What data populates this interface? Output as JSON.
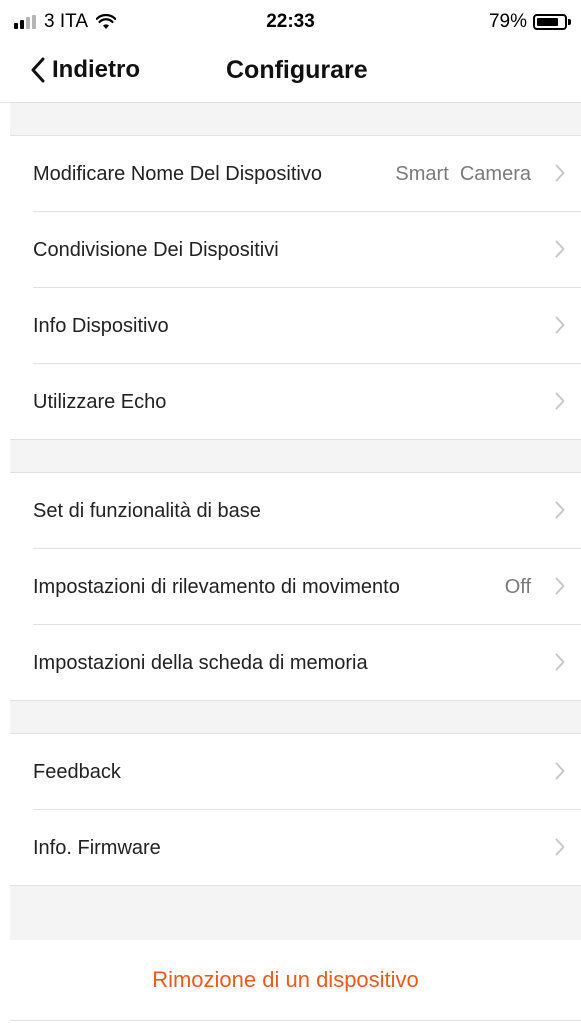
{
  "status_bar": {
    "carrier": "3 ITA",
    "time": "22:33",
    "battery_percent": "79%",
    "battery_level": 0.79
  },
  "nav": {
    "back_label": "Indietro",
    "title": "Configurare"
  },
  "sections": [
    {
      "rows": [
        {
          "name": "row-rename-device",
          "label": "Modificare Nome Del Dispositivo",
          "value": "Smart  Camera"
        },
        {
          "name": "row-device-sharing",
          "label": "Condivisione Dei Dispositivi",
          "value": ""
        },
        {
          "name": "row-device-info",
          "label": "Info Dispositivo",
          "value": ""
        },
        {
          "name": "row-use-echo",
          "label": "Utilizzare Echo",
          "value": ""
        }
      ]
    },
    {
      "rows": [
        {
          "name": "row-basic-features",
          "label": "Set di funzionalità di base",
          "value": ""
        },
        {
          "name": "row-motion-detection",
          "label": "Impostazioni di rilevamento di movimento",
          "value": "Off"
        },
        {
          "name": "row-memory-card",
          "label": "Impostazioni della scheda di memoria",
          "value": ""
        }
      ]
    },
    {
      "rows": [
        {
          "name": "row-feedback",
          "label": "Feedback",
          "value": ""
        },
        {
          "name": "row-firmware-info",
          "label": "Info. Firmware",
          "value": ""
        }
      ]
    }
  ],
  "remove_device_label": "Rimozione di un dispositivo",
  "colors": {
    "accent_remove": "#ef5a1c",
    "group_background": "#f4f4f4",
    "separator": "#e2e2e2",
    "chevron": "#c7c7cc",
    "secondary_text": "#7a7a7a"
  },
  "icons": {
    "back": "chevron-left-icon",
    "row_disclosure": "chevron-right-icon",
    "wifi": "wifi-icon",
    "signal": "signal-bars-icon",
    "battery": "battery-icon"
  }
}
